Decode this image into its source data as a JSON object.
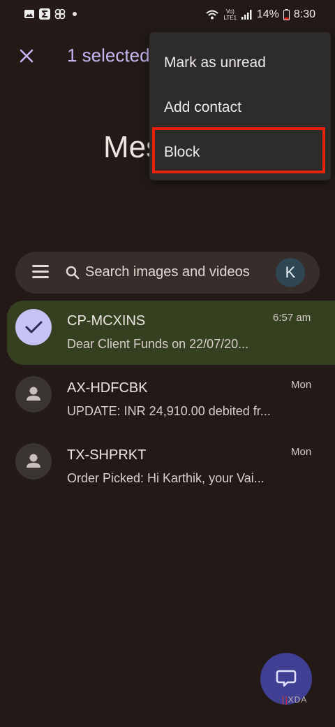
{
  "status_bar": {
    "time": "8:30",
    "battery": "14%",
    "net_label": "Vo) LTE1",
    "left_icons": [
      "gallery-icon",
      "sigma-icon",
      "pinwheel-icon",
      "dot"
    ]
  },
  "appbar": {
    "selected_text": "1 selected"
  },
  "title_fragment": "Mes",
  "menu": {
    "items": [
      {
        "label": "Mark as unread"
      },
      {
        "label": "Add contact"
      },
      {
        "label": "Block"
      }
    ],
    "highlight_color": "#e8210c"
  },
  "search": {
    "placeholder": "Search images and videos",
    "avatar_letter": "K"
  },
  "conversations": [
    {
      "sender": "CP-MCXINS",
      "snippet": "Dear Client Funds on 22/07/20...",
      "time": "6:57 am",
      "selected": true
    },
    {
      "sender": "AX-HDFCBK",
      "snippet": "UPDATE: INR 24,910.00 debited fr...",
      "time": "Mon",
      "selected": false
    },
    {
      "sender": "TX-SHPRKT",
      "snippet": "Order Picked: Hi Karthik, your Vai...",
      "time": "Mon",
      "selected": false
    }
  ],
  "watermark": "XDA",
  "colors": {
    "background": "#231a18",
    "selected_row": "#34401f",
    "accent": "#c3b6f2",
    "fab": "#3f3f93"
  }
}
